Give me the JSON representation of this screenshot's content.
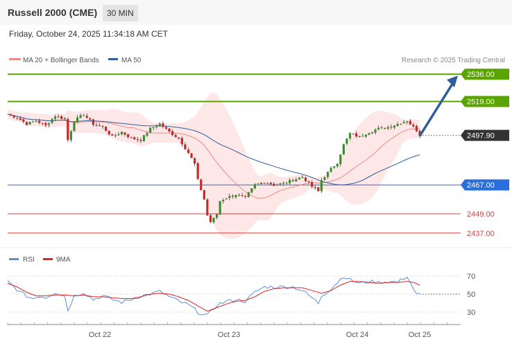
{
  "header": {
    "title": "Russell 2000 (CME)",
    "timeframe": "30 MIN"
  },
  "datetime": "Friday, October 24, 2025 11:34:18 AM CET",
  "legend": [
    {
      "label": "MA 20 + Bollinger Bands",
      "color": "#f08a8a"
    },
    {
      "label": "MA 50",
      "color": "#2d5d9b"
    }
  ],
  "credit": "Research © 2025 Trading Central",
  "colors": {
    "up": "#3c8d2f",
    "down": "#c62828",
    "resistance": "#5aa400",
    "pivot": "#2a6fdb",
    "support": "#d24040",
    "arrow": "#2d5d9b",
    "ma20": "#f08a8a",
    "ma50": "#2d5d9b",
    "band": "#fde3e3",
    "rsi": "#5b8ddc",
    "rsi_ma": "#dd2222"
  },
  "chart_data": [
    {
      "type": "candlestick",
      "title": "Russell 2000 (CME)",
      "interval": "30 MIN",
      "ylim": [
        2430,
        2543
      ],
      "x_labels": [
        "Oct 22",
        "Oct 23",
        "Oct 24",
        "Oct 25"
      ],
      "levels": [
        {
          "value": 2536.0,
          "label": "2536.00",
          "kind": "resistance"
        },
        {
          "value": 2519.0,
          "label": "2519.00",
          "kind": "resistance"
        },
        {
          "value": 2497.9,
          "label": "2497.90",
          "kind": "last"
        },
        {
          "value": 2467.0,
          "label": "2467.00",
          "kind": "pivot"
        },
        {
          "value": 2449.0,
          "label": "2449.00",
          "kind": "support"
        },
        {
          "value": 2437.0,
          "label": "2437.00",
          "kind": "support"
        }
      ],
      "close_path": [
        [
          0,
          2511
        ],
        [
          3,
          2509
        ],
        [
          6,
          2505
        ],
        [
          9,
          2507
        ],
        [
          12,
          2504
        ],
        [
          15,
          2510
        ],
        [
          18,
          2508
        ],
        [
          19,
          2495
        ],
        [
          21,
          2507
        ],
        [
          24,
          2511
        ],
        [
          27,
          2505
        ],
        [
          30,
          2503
        ],
        [
          33,
          2497
        ],
        [
          36,
          2500
        ],
        [
          39,
          2496
        ],
        [
          42,
          2495
        ],
        [
          45,
          2502
        ],
        [
          48,
          2505
        ],
        [
          51,
          2500
        ],
        [
          54,
          2496
        ],
        [
          57,
          2487
        ],
        [
          59,
          2480
        ],
        [
          60,
          2470
        ],
        [
          62,
          2458
        ],
        [
          63,
          2448
        ],
        [
          64,
          2444
        ],
        [
          65,
          2446
        ],
        [
          66,
          2449
        ],
        [
          67,
          2457
        ],
        [
          69,
          2459
        ],
        [
          72,
          2461
        ],
        [
          75,
          2459
        ],
        [
          78,
          2467
        ],
        [
          81,
          2469
        ],
        [
          84,
          2467
        ],
        [
          87,
          2468
        ],
        [
          90,
          2470
        ],
        [
          93,
          2472
        ],
        [
          96,
          2466
        ],
        [
          98,
          2463
        ],
        [
          99,
          2470
        ],
        [
          102,
          2477
        ],
        [
          104,
          2481
        ],
        [
          106,
          2492
        ],
        [
          108,
          2499
        ],
        [
          111,
          2497
        ],
        [
          114,
          2500
        ],
        [
          117,
          2502
        ],
        [
          120,
          2503
        ],
        [
          123,
          2505
        ],
        [
          126,
          2507
        ],
        [
          128,
          2503
        ],
        [
          129,
          2501
        ],
        [
          130,
          2498
        ]
      ],
      "forecast_target": 2536.0,
      "series": [
        {
          "name": "MA 20 + Bollinger Bands"
        },
        {
          "name": "MA 50"
        }
      ]
    },
    {
      "type": "line",
      "ylim": [
        20,
        80
      ],
      "y_ticks": [
        70,
        50,
        30
      ],
      "reference_line": 50,
      "series_names": [
        "RSI",
        "9MA"
      ],
      "rsi": [
        [
          0,
          64
        ],
        [
          2,
          58
        ],
        [
          4,
          52
        ],
        [
          6,
          48
        ],
        [
          8,
          45
        ],
        [
          10,
          48
        ],
        [
          12,
          46
        ],
        [
          15,
          52
        ],
        [
          18,
          48
        ],
        [
          19,
          32
        ],
        [
          21,
          48
        ],
        [
          24,
          52
        ],
        [
          27,
          44
        ],
        [
          30,
          48
        ],
        [
          33,
          44
        ],
        [
          36,
          41
        ],
        [
          39,
          44
        ],
        [
          42,
          48
        ],
        [
          45,
          50
        ],
        [
          48,
          53
        ],
        [
          51,
          47
        ],
        [
          54,
          42
        ],
        [
          57,
          38
        ],
        [
          59,
          33
        ],
        [
          60,
          30
        ],
        [
          62,
          27
        ],
        [
          63,
          26
        ],
        [
          64,
          30
        ],
        [
          66,
          38
        ],
        [
          69,
          42
        ],
        [
          72,
          44
        ],
        [
          75,
          42
        ],
        [
          78,
          52
        ],
        [
          81,
          58
        ],
        [
          84,
          58
        ],
        [
          87,
          58
        ],
        [
          90,
          58
        ],
        [
          93,
          54
        ],
        [
          96,
          46
        ],
        [
          98,
          40
        ],
        [
          99,
          48
        ],
        [
          102,
          56
        ],
        [
          104,
          63
        ],
        [
          106,
          70
        ],
        [
          108,
          66
        ],
        [
          111,
          62
        ],
        [
          114,
          64
        ],
        [
          117,
          63
        ],
        [
          120,
          64
        ],
        [
          123,
          63
        ],
        [
          126,
          70
        ],
        [
          128,
          56
        ],
        [
          129,
          49
        ],
        [
          130,
          50
        ]
      ],
      "rsi_ma": [
        [
          0,
          62
        ],
        [
          3,
          58
        ],
        [
          6,
          52
        ],
        [
          9,
          48
        ],
        [
          12,
          48
        ],
        [
          15,
          49
        ],
        [
          18,
          49
        ],
        [
          21,
          48
        ],
        [
          24,
          49
        ],
        [
          27,
          47
        ],
        [
          30,
          47
        ],
        [
          33,
          46
        ],
        [
          36,
          45
        ],
        [
          39,
          45
        ],
        [
          42,
          47
        ],
        [
          45,
          50
        ],
        [
          48,
          51
        ],
        [
          51,
          50
        ],
        [
          54,
          47
        ],
        [
          57,
          43
        ],
        [
          60,
          37
        ],
        [
          63,
          31
        ],
        [
          66,
          35
        ],
        [
          69,
          39
        ],
        [
          72,
          42
        ],
        [
          75,
          43
        ],
        [
          78,
          47
        ],
        [
          81,
          53
        ],
        [
          84,
          56
        ],
        [
          87,
          57
        ],
        [
          90,
          57
        ],
        [
          93,
          57
        ],
        [
          96,
          54
        ],
        [
          99,
          51
        ],
        [
          102,
          54
        ],
        [
          105,
          60
        ],
        [
          108,
          64
        ],
        [
          111,
          64
        ],
        [
          114,
          63
        ],
        [
          117,
          62
        ],
        [
          120,
          63
        ],
        [
          123,
          63
        ],
        [
          126,
          64
        ],
        [
          128,
          63
        ],
        [
          130,
          60
        ]
      ]
    }
  ]
}
